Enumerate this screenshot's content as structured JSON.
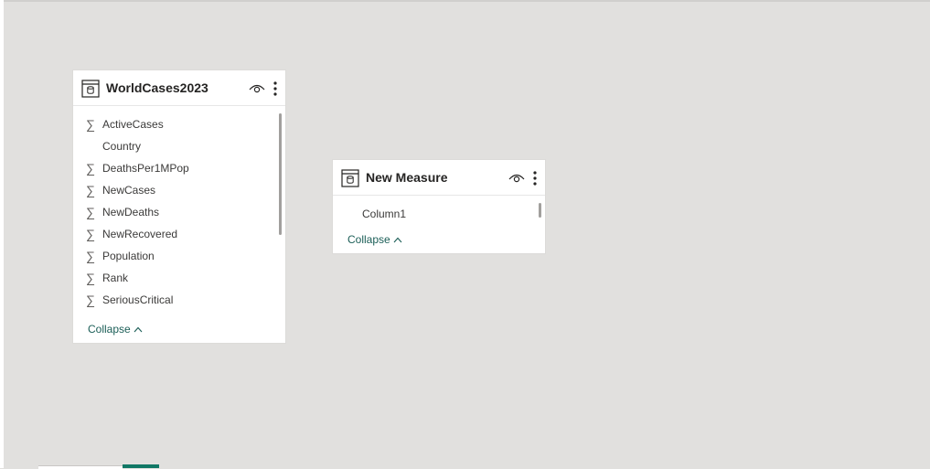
{
  "canvas": {
    "background": "#e1e0de",
    "accent": "#117865"
  },
  "tables": [
    {
      "title": "WorldCases2023",
      "fields": [
        {
          "label": "ActiveCases",
          "summarized": true
        },
        {
          "label": "Country",
          "summarized": false
        },
        {
          "label": "DeathsPer1MPop",
          "summarized": true
        },
        {
          "label": "NewCases",
          "summarized": true
        },
        {
          "label": "NewDeaths",
          "summarized": true
        },
        {
          "label": "NewRecovered",
          "summarized": true
        },
        {
          "label": "Population",
          "summarized": true
        },
        {
          "label": "Rank",
          "summarized": true
        },
        {
          "label": "SeriousCritical",
          "summarized": true
        }
      ],
      "collapse_label": "Collapse",
      "icons": [
        "table-icon",
        "eye-icon",
        "more-options-icon",
        "sigma-icon",
        "chevron-up-icon"
      ]
    },
    {
      "title": "New Measure",
      "fields": [
        {
          "label": "Column1",
          "summarized": false
        }
      ],
      "collapse_label": "Collapse",
      "icons": [
        "table-icon",
        "eye-icon",
        "more-options-icon",
        "chevron-up-icon"
      ]
    }
  ],
  "sigma_glyph": "∑"
}
